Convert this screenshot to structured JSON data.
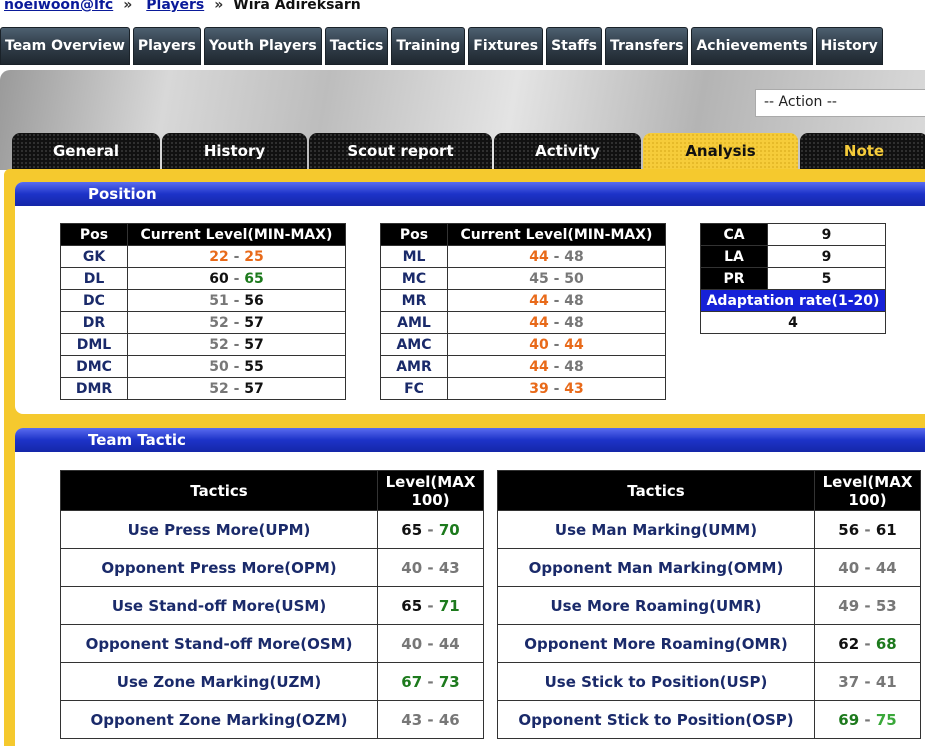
{
  "breadcrumb": {
    "user": "noeiwoon@lfc",
    "sep": "»",
    "section": "Players",
    "current": "Wira Adireksarn"
  },
  "topnav": [
    "Team Overview",
    "Players",
    "Youth Players",
    "Tactics",
    "Training",
    "Fixtures",
    "Staffs",
    "Transfers",
    "Achievements",
    "History"
  ],
  "action": {
    "value": "-- Action --"
  },
  "tabs": [
    "General",
    "History",
    "Scout report",
    "Activity",
    "Analysis",
    "Note"
  ],
  "active_tab": "Analysis",
  "position": {
    "title": "Position",
    "col_pos": "Pos",
    "col_level": "Current Level(MIN-MAX)",
    "left": [
      {
        "pos": "GK",
        "min": "22",
        "max": "25",
        "cmin": "or",
        "cmax": "or"
      },
      {
        "pos": "DL",
        "min": "60",
        "max": "65",
        "cmin": "bk",
        "cmax": "gn"
      },
      {
        "pos": "DC",
        "min": "51",
        "max": "56",
        "cmin": "gr",
        "cmax": "bk"
      },
      {
        "pos": "DR",
        "min": "52",
        "max": "57",
        "cmin": "gr",
        "cmax": "bk"
      },
      {
        "pos": "DML",
        "min": "52",
        "max": "57",
        "cmin": "gr",
        "cmax": "bk"
      },
      {
        "pos": "DMC",
        "min": "50",
        "max": "55",
        "cmin": "gr",
        "cmax": "bk"
      },
      {
        "pos": "DMR",
        "min": "52",
        "max": "57",
        "cmin": "gr",
        "cmax": "bk"
      }
    ],
    "right": [
      {
        "pos": "ML",
        "min": "44",
        "max": "48",
        "cmin": "or",
        "cmax": "gr"
      },
      {
        "pos": "MC",
        "min": "45",
        "max": "50",
        "cmin": "gr",
        "cmax": "gr"
      },
      {
        "pos": "MR",
        "min": "44",
        "max": "48",
        "cmin": "or",
        "cmax": "gr"
      },
      {
        "pos": "AML",
        "min": "44",
        "max": "48",
        "cmin": "or",
        "cmax": "gr"
      },
      {
        "pos": "AMC",
        "min": "40",
        "max": "44",
        "cmin": "or",
        "cmax": "or"
      },
      {
        "pos": "AMR",
        "min": "44",
        "max": "48",
        "cmin": "or",
        "cmax": "gr"
      },
      {
        "pos": "FC",
        "min": "39",
        "max": "43",
        "cmin": "or",
        "cmax": "or"
      }
    ],
    "stats": {
      "ca_label": "CA",
      "ca": "9",
      "la_label": "LA",
      "la": "9",
      "pr_label": "PR",
      "pr": "5",
      "adapt_label": "Adaptation rate(1-20)",
      "adapt": "4"
    }
  },
  "tactic": {
    "title": "Team Tactic",
    "col_tactics": "Tactics",
    "col_level": "Level(MAX 100)",
    "left": [
      {
        "name": "Use Press More(UPM)",
        "min": "65",
        "max": "70",
        "cmin": "bk",
        "cmax": "gn"
      },
      {
        "name": "Opponent Press More(OPM)",
        "min": "40",
        "max": "43",
        "cmin": "gr",
        "cmax": "gr"
      },
      {
        "name": "Use Stand-off More(USM)",
        "min": "65",
        "max": "71",
        "cmin": "bk",
        "cmax": "gn"
      },
      {
        "name": "Opponent Stand-off More(OSM)",
        "min": "40",
        "max": "44",
        "cmin": "gr",
        "cmax": "gr"
      },
      {
        "name": "Use Zone Marking(UZM)",
        "min": "67",
        "max": "73",
        "cmin": "gn",
        "cmax": "gn"
      },
      {
        "name": "Opponent Zone Marking(OZM)",
        "min": "43",
        "max": "46",
        "cmin": "gr",
        "cmax": "gr"
      }
    ],
    "right": [
      {
        "name": "Use Man Marking(UMM)",
        "min": "56",
        "max": "61",
        "cmin": "bk",
        "cmax": "bk"
      },
      {
        "name": "Opponent Man Marking(OMM)",
        "min": "40",
        "max": "44",
        "cmin": "gr",
        "cmax": "gr"
      },
      {
        "name": "Use More Roaming(UMR)",
        "min": "49",
        "max": "53",
        "cmin": "gr",
        "cmax": "gr"
      },
      {
        "name": "Opponent More Roaming(OMR)",
        "min": "62",
        "max": "68",
        "cmin": "bk",
        "cmax": "gn"
      },
      {
        "name": "Use Stick to Position(USP)",
        "min": "37",
        "max": "41",
        "cmin": "gr",
        "cmax": "gr"
      },
      {
        "name": "Opponent Stick to Position(OSP)",
        "min": "69",
        "max": "75",
        "cmin": "gn",
        "cmax": "lg"
      }
    ]
  }
}
